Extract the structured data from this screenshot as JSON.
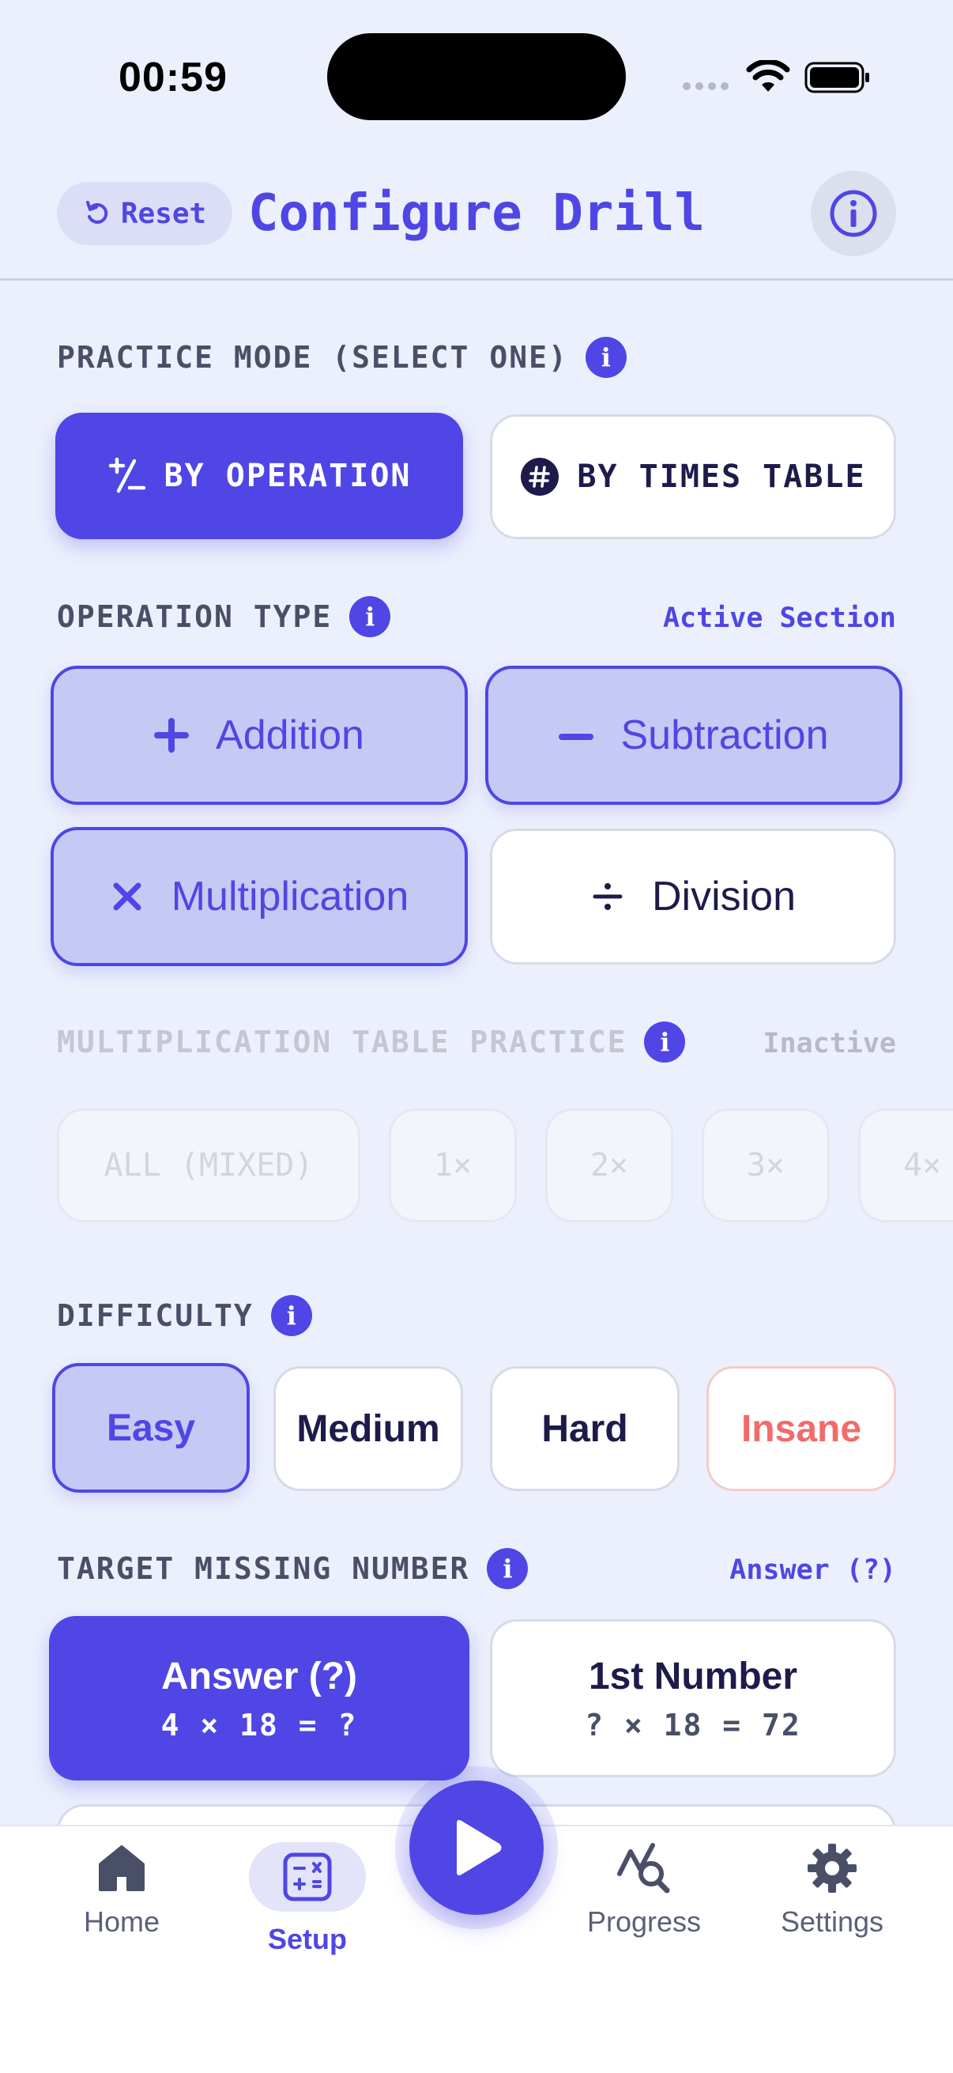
{
  "status_bar": {
    "time": "00:59"
  },
  "header": {
    "reset_label": "Reset",
    "title": "Configure Drill"
  },
  "practice_mode": {
    "label": "PRACTICE MODE (SELECT ONE)",
    "options": [
      {
        "label": "BY OPERATION",
        "selected": true
      },
      {
        "label": "BY TIMES TABLE",
        "selected": false
      }
    ]
  },
  "operation_type": {
    "label": "OPERATION TYPE",
    "status": "Active Section",
    "options": [
      {
        "symbol": "+",
        "label": "Addition",
        "selected": true
      },
      {
        "symbol": "−",
        "label": "Subtraction",
        "selected": true
      },
      {
        "symbol": "×",
        "label": "Multiplication",
        "selected": true
      },
      {
        "symbol": "÷",
        "label": "Division",
        "selected": false
      }
    ]
  },
  "table_practice": {
    "label": "MULTIPLICATION TABLE PRACTICE",
    "status": "Inactive",
    "chips": [
      "ALL (MIXED)",
      "1×",
      "2×",
      "3×",
      "4×"
    ]
  },
  "difficulty": {
    "label": "DIFFICULTY",
    "options": [
      {
        "label": "Easy",
        "selected": true
      },
      {
        "label": "Medium",
        "selected": false
      },
      {
        "label": "Hard",
        "selected": false
      },
      {
        "label": "Insane",
        "selected": false
      }
    ]
  },
  "target": {
    "label": "TARGET MISSING NUMBER",
    "status": "Answer (?)",
    "options": [
      {
        "title": "Answer (?)",
        "example": "4 × 18 = ?",
        "selected": true
      },
      {
        "title": "1st Number",
        "example": "? × 18 = 72",
        "selected": false
      }
    ]
  },
  "nav": {
    "items": [
      {
        "label": "Home",
        "icon": "home-icon"
      },
      {
        "label": "Setup",
        "icon": "calculator-icon",
        "active": true
      },
      {
        "label": "Progress",
        "icon": "progress-search-icon"
      },
      {
        "label": "Settings",
        "icon": "gear-icon"
      }
    ],
    "play_icon": "play-icon"
  },
  "colors": {
    "accent": "#4F46E5",
    "background": "#ECF0FC",
    "insane": "#F26B6B"
  }
}
